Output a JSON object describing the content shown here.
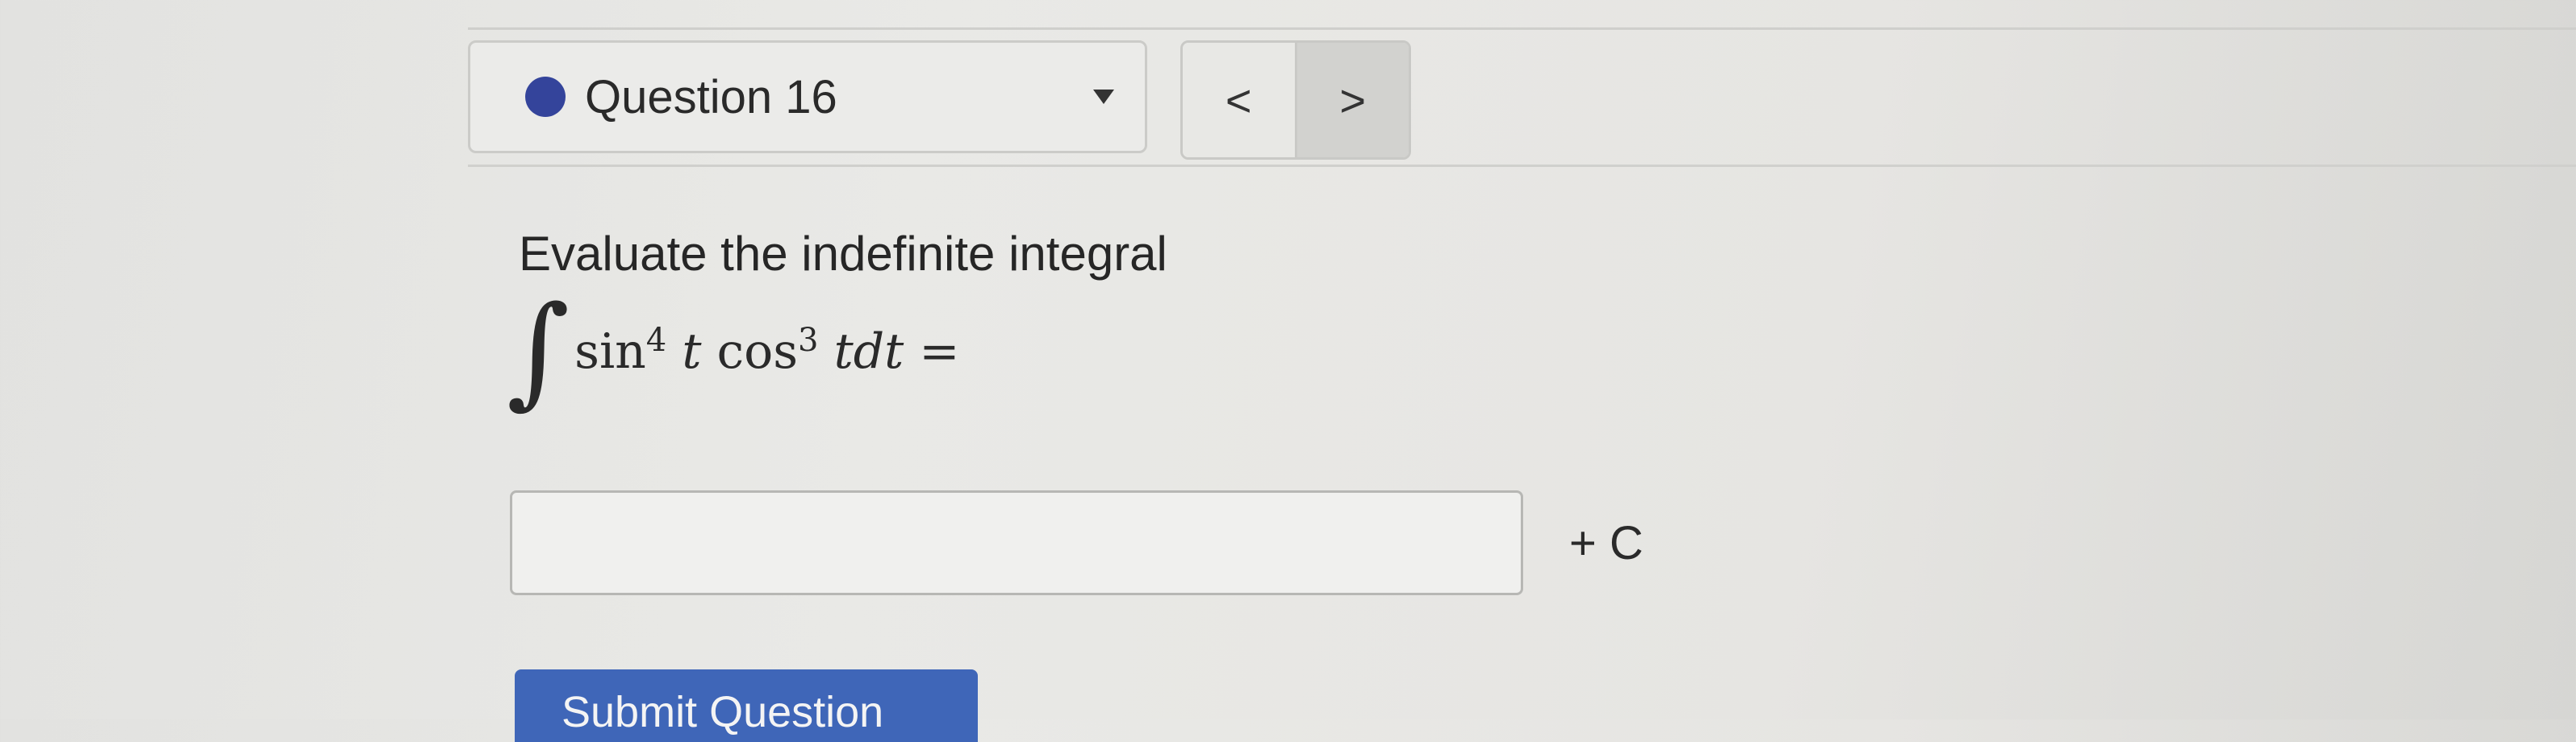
{
  "question_selector": {
    "title": "Question 16",
    "status_color": "#34449b"
  },
  "navigation": {
    "prev_label": "<",
    "next_label": ">"
  },
  "problem": {
    "prompt": "Evaluate the indefinite integral",
    "integral_symbol": "∫",
    "expression": {
      "fn1": "sin",
      "exp1": "4",
      "var1": "t",
      "fn2": "cos",
      "exp2": "3",
      "var2": "tdt",
      "equals": "="
    }
  },
  "answer": {
    "value": "",
    "suffix": "+ C"
  },
  "submit": {
    "label": "Submit Question",
    "color": "#3f66b8"
  }
}
